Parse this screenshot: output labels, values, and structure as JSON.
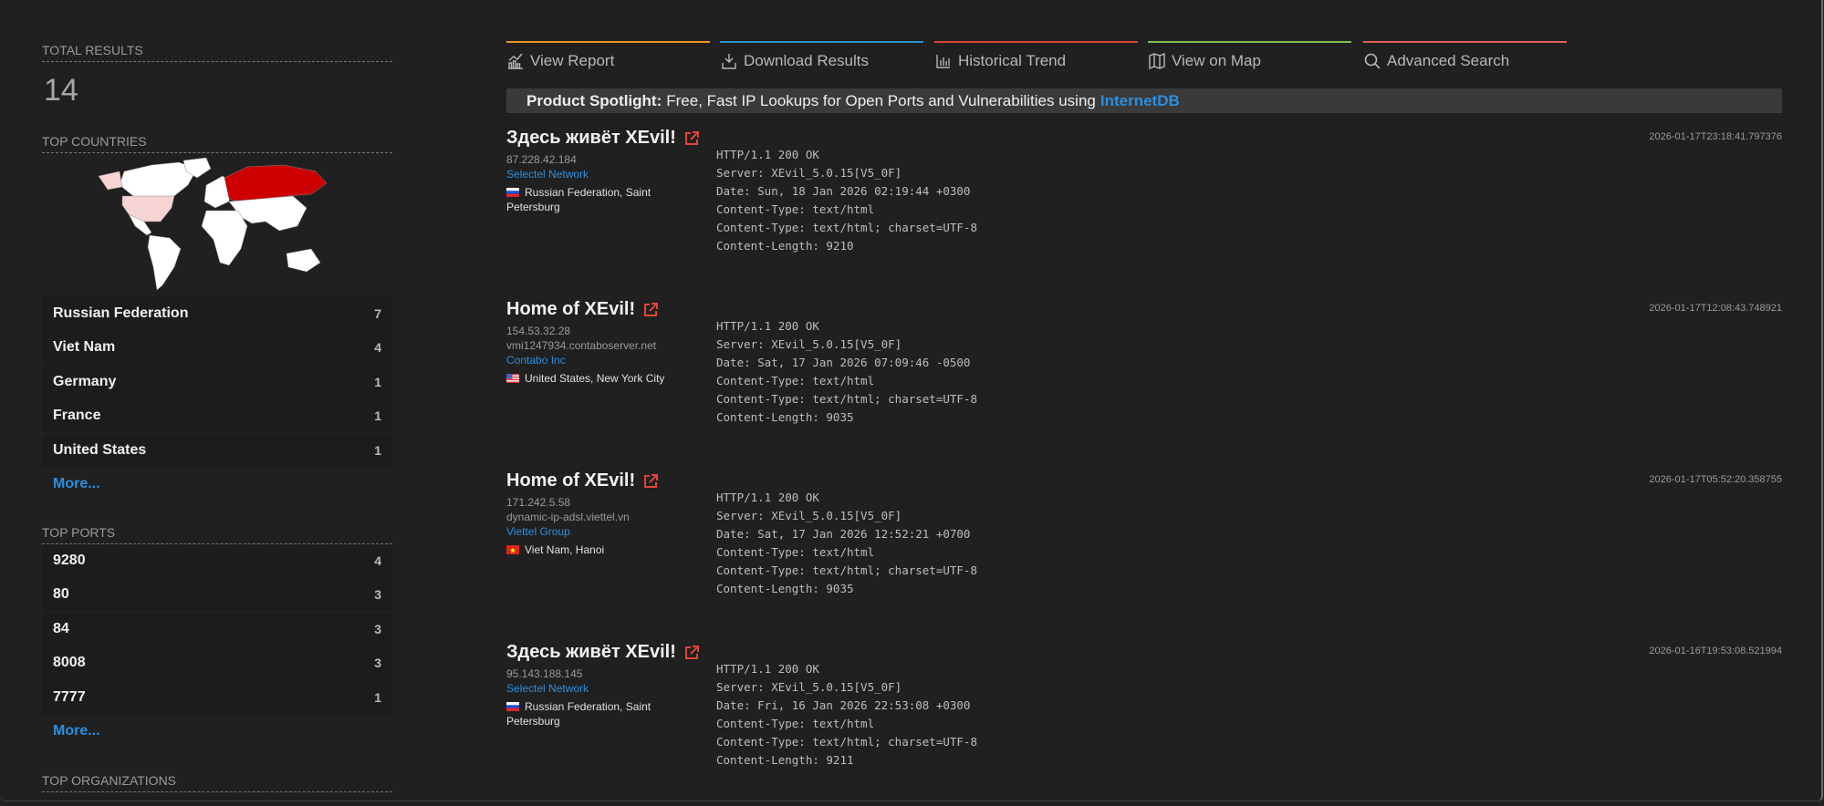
{
  "sidebar": {
    "total_results": {
      "label": "Total Results",
      "value": "14"
    },
    "top_countries": {
      "label": "Top Countries",
      "items": [
        {
          "name": "Russian Federation",
          "count": "7"
        },
        {
          "name": "Viet Nam",
          "count": "4"
        },
        {
          "name": "Germany",
          "count": "1"
        },
        {
          "name": "France",
          "count": "1"
        },
        {
          "name": "United States",
          "count": "1"
        }
      ],
      "more": "More..."
    },
    "top_ports": {
      "label": "Top Ports",
      "items": [
        {
          "name": "9280",
          "count": "4"
        },
        {
          "name": "80",
          "count": "3"
        },
        {
          "name": "84",
          "count": "3"
        },
        {
          "name": "8008",
          "count": "3"
        },
        {
          "name": "7777",
          "count": "1"
        }
      ],
      "more": "More..."
    },
    "top_organizations": {
      "label": "Top Organizations"
    }
  },
  "tabs": [
    {
      "label": "View Report",
      "icon": "chart-icon",
      "color": "#e8961e"
    },
    {
      "label": "Download Results",
      "icon": "download-icon",
      "color": "#2a8fcf"
    },
    {
      "label": "Historical Trend",
      "icon": "bar-chart-icon",
      "color": "#d9453a"
    },
    {
      "label": "View on Map",
      "icon": "map-icon",
      "color": "#7cc04a"
    },
    {
      "label": "Advanced Search",
      "icon": "search-icon",
      "color": "#e0605a"
    }
  ],
  "banner": {
    "label": "Product Spotlight:",
    "text": "Free, Fast IP Lookups for Open Ports and Vulnerabilities using",
    "link": "InternetDB"
  },
  "colors": {
    "accent": "#2a8fe0",
    "russia": "#cc0000",
    "us_highlight": "#f7d4d4"
  },
  "results": [
    {
      "title": "Здесь живёт XEvil!",
      "ip": "87.228.42.184",
      "hostname": "",
      "org": "Selectel Network",
      "flag": "ru",
      "location": "Russian Federation, Saint Petersburg",
      "timestamp": "2026-01-17T23:18:41.797376",
      "data": [
        "HTTP/1.1 200 OK",
        "Server: XEvil_5.0.15[V5_0F]",
        "Date: Sun, 18 Jan 2026 02:19:44 +0300",
        "Content-Type: text/html",
        "Content-Type: text/html; charset=UTF-8",
        "Content-Length: 9210"
      ]
    },
    {
      "title": "Home of XEvil!",
      "ip": "154.53.32.28",
      "hostname": "vmi1247934.contaboserver.net",
      "org": "Contabo Inc",
      "flag": "us",
      "location": "United States, New York City",
      "timestamp": "2026-01-17T12:08:43.748921",
      "data": [
        "HTTP/1.1 200 OK",
        "Server: XEvil_5.0.15[V5_0F]",
        "Date: Sat, 17 Jan 2026 07:09:46 -0500",
        "Content-Type: text/html",
        "Content-Type: text/html; charset=UTF-8",
        "Content-Length: 9035"
      ]
    },
    {
      "title": "Home of XEvil!",
      "ip": "171.242.5.58",
      "hostname": "dynamic-ip-adsl.viettel.vn",
      "org": "Viettel Group",
      "flag": "vn",
      "location": "Viet Nam, Hanoi",
      "timestamp": "2026-01-17T05:52:20.358755",
      "data": [
        "HTTP/1.1 200 OK",
        "Server: XEvil_5.0.15[V5_0F]",
        "Date: Sat, 17 Jan 2026 12:52:21 +0700",
        "Content-Type: text/html",
        "Content-Type: text/html; charset=UTF-8",
        "Content-Length: 9035"
      ]
    },
    {
      "title": "Здесь живёт XEvil!",
      "ip": "95.143.188.145",
      "hostname": "",
      "org": "Selectel Network",
      "flag": "ru",
      "location": "Russian Federation, Saint Petersburg",
      "timestamp": "2026-01-16T19:53:08.521994",
      "data": [
        "HTTP/1.1 200 OK",
        "Server: XEvil_5.0.15[V5_0F]",
        "Date: Fri, 16 Jan 2026 22:53:08 +0300",
        "Content-Type: text/html",
        "Content-Type: text/html; charset=UTF-8",
        "Content-Length: 9211"
      ]
    }
  ]
}
